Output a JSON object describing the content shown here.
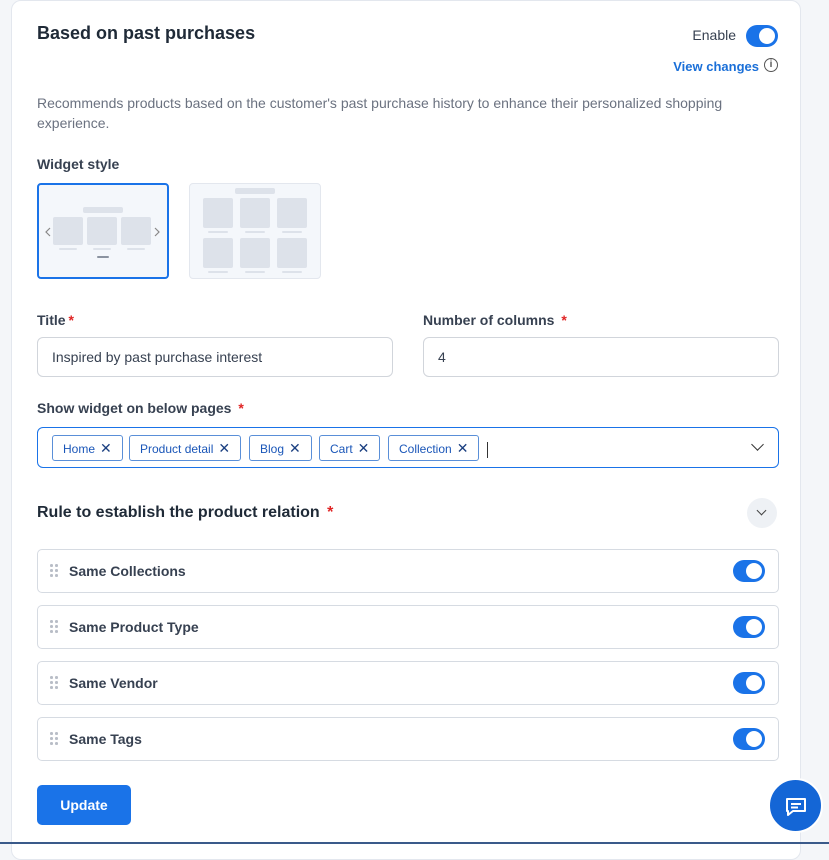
{
  "header": {
    "title": "Based on past purchases",
    "enable_label": "Enable",
    "enabled": true,
    "view_changes": "View changes"
  },
  "description": "Recommends products based on the customer's past purchase history to enhance their personalized shopping experience.",
  "widget_style": {
    "label": "Widget style",
    "options": [
      "carousel",
      "grid"
    ],
    "selected": "carousel"
  },
  "title_field": {
    "label": "Title",
    "required_mark": "*",
    "value": "Inspired by past purchase interest"
  },
  "columns_field": {
    "label": "Number of columns",
    "required_mark": "*",
    "value": "4"
  },
  "pages_field": {
    "label": "Show widget on below pages",
    "required_mark": "*",
    "tags": [
      "Home",
      "Product detail",
      "Blog",
      "Cart",
      "Collection"
    ],
    "remove_glyph": "✕"
  },
  "rules": {
    "label": "Rule to establish the product relation",
    "required_mark": "*",
    "items": [
      {
        "label": "Same Collections",
        "enabled": true
      },
      {
        "label": "Same Product Type",
        "enabled": true
      },
      {
        "label": "Same Vendor",
        "enabled": true
      },
      {
        "label": "Same Tags",
        "enabled": true
      }
    ]
  },
  "actions": {
    "update_label": "Update"
  },
  "icons": {
    "info": "info-icon",
    "chat": "chat-icon",
    "drag": "drag-handle-icon",
    "chevron": "chevron-down-icon"
  },
  "colors": {
    "accent": "#1a73e8",
    "required": "#e02424"
  }
}
